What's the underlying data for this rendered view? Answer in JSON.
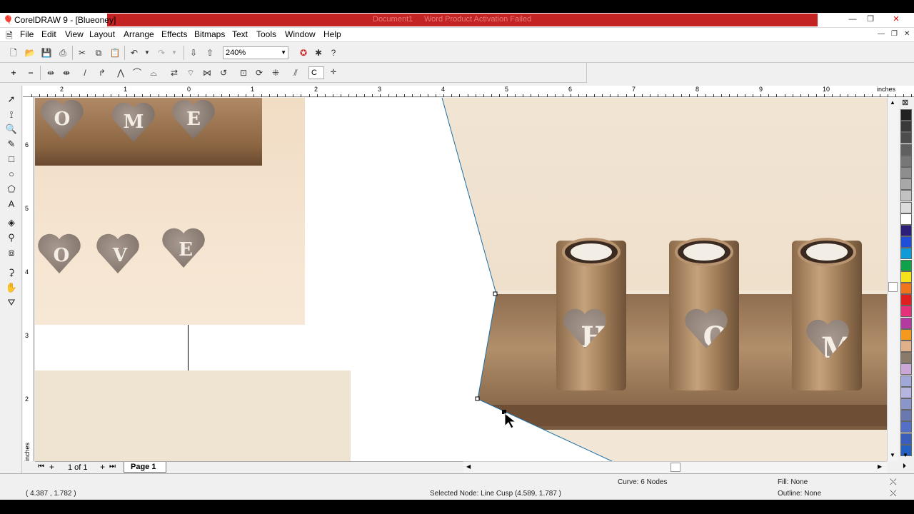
{
  "window": {
    "title": "CorelDRAW 9 - [Blueoney]",
    "ghost_text_1": "Document1",
    "ghost_text_2": "Word Product Activation Failed",
    "min": "—",
    "max": "❐",
    "close": "✕"
  },
  "menu": [
    "File",
    "Edit",
    "View",
    "Layout",
    "Arrange",
    "Effects",
    "Bitmaps",
    "Text",
    "Tools",
    "Window",
    "Help"
  ],
  "toolbar": {
    "zoom_value": "240%",
    "node_field": "C"
  },
  "ruler": {
    "unit": "inches",
    "h_labels": [
      "2",
      "1",
      "0",
      "1",
      "2",
      "3",
      "4",
      "5",
      "6",
      "7",
      "8",
      "9",
      "10"
    ],
    "v_labels": [
      "6",
      "5",
      "4",
      "3",
      "2"
    ]
  },
  "canvas": {
    "hearts_top": [
      "O",
      "M",
      "E"
    ],
    "hearts_mid": [
      "O",
      "V",
      "E"
    ],
    "hearts_main": [
      "H",
      "O",
      "M"
    ]
  },
  "pagebar": {
    "page_count": "1 of 1",
    "page_tab": "Page 1"
  },
  "status": {
    "coords": "( 4.387 , 1.782 )",
    "curve": "Curve: 6 Nodes",
    "selected_node": "Selected Node: Line Cusp (4.589, 1.787 )",
    "fill": "Fill: None",
    "outline": "Outline: None"
  },
  "palette": [
    "#222222",
    "#3a3a3a",
    "#4d4d4d",
    "#606060",
    "#777777",
    "#8e8e8e",
    "#a8a8a8",
    "#c2c2c2",
    "#dcdcdc",
    "#ffffff",
    "#2b1f7a",
    "#1e4fd6",
    "#0f9ad8",
    "#10a24a",
    "#f5e21a",
    "#f0741b",
    "#e02020",
    "#e5307a",
    "#b53aa0",
    "#f39a1e",
    "#e0b08a",
    "#8a7a6a",
    "#c9a7d6",
    "#9fa8d8",
    "#b5b5e0",
    "#8a96c9",
    "#6a78b0",
    "#5470c6",
    "#3b5fb8",
    "#2660c0"
  ]
}
